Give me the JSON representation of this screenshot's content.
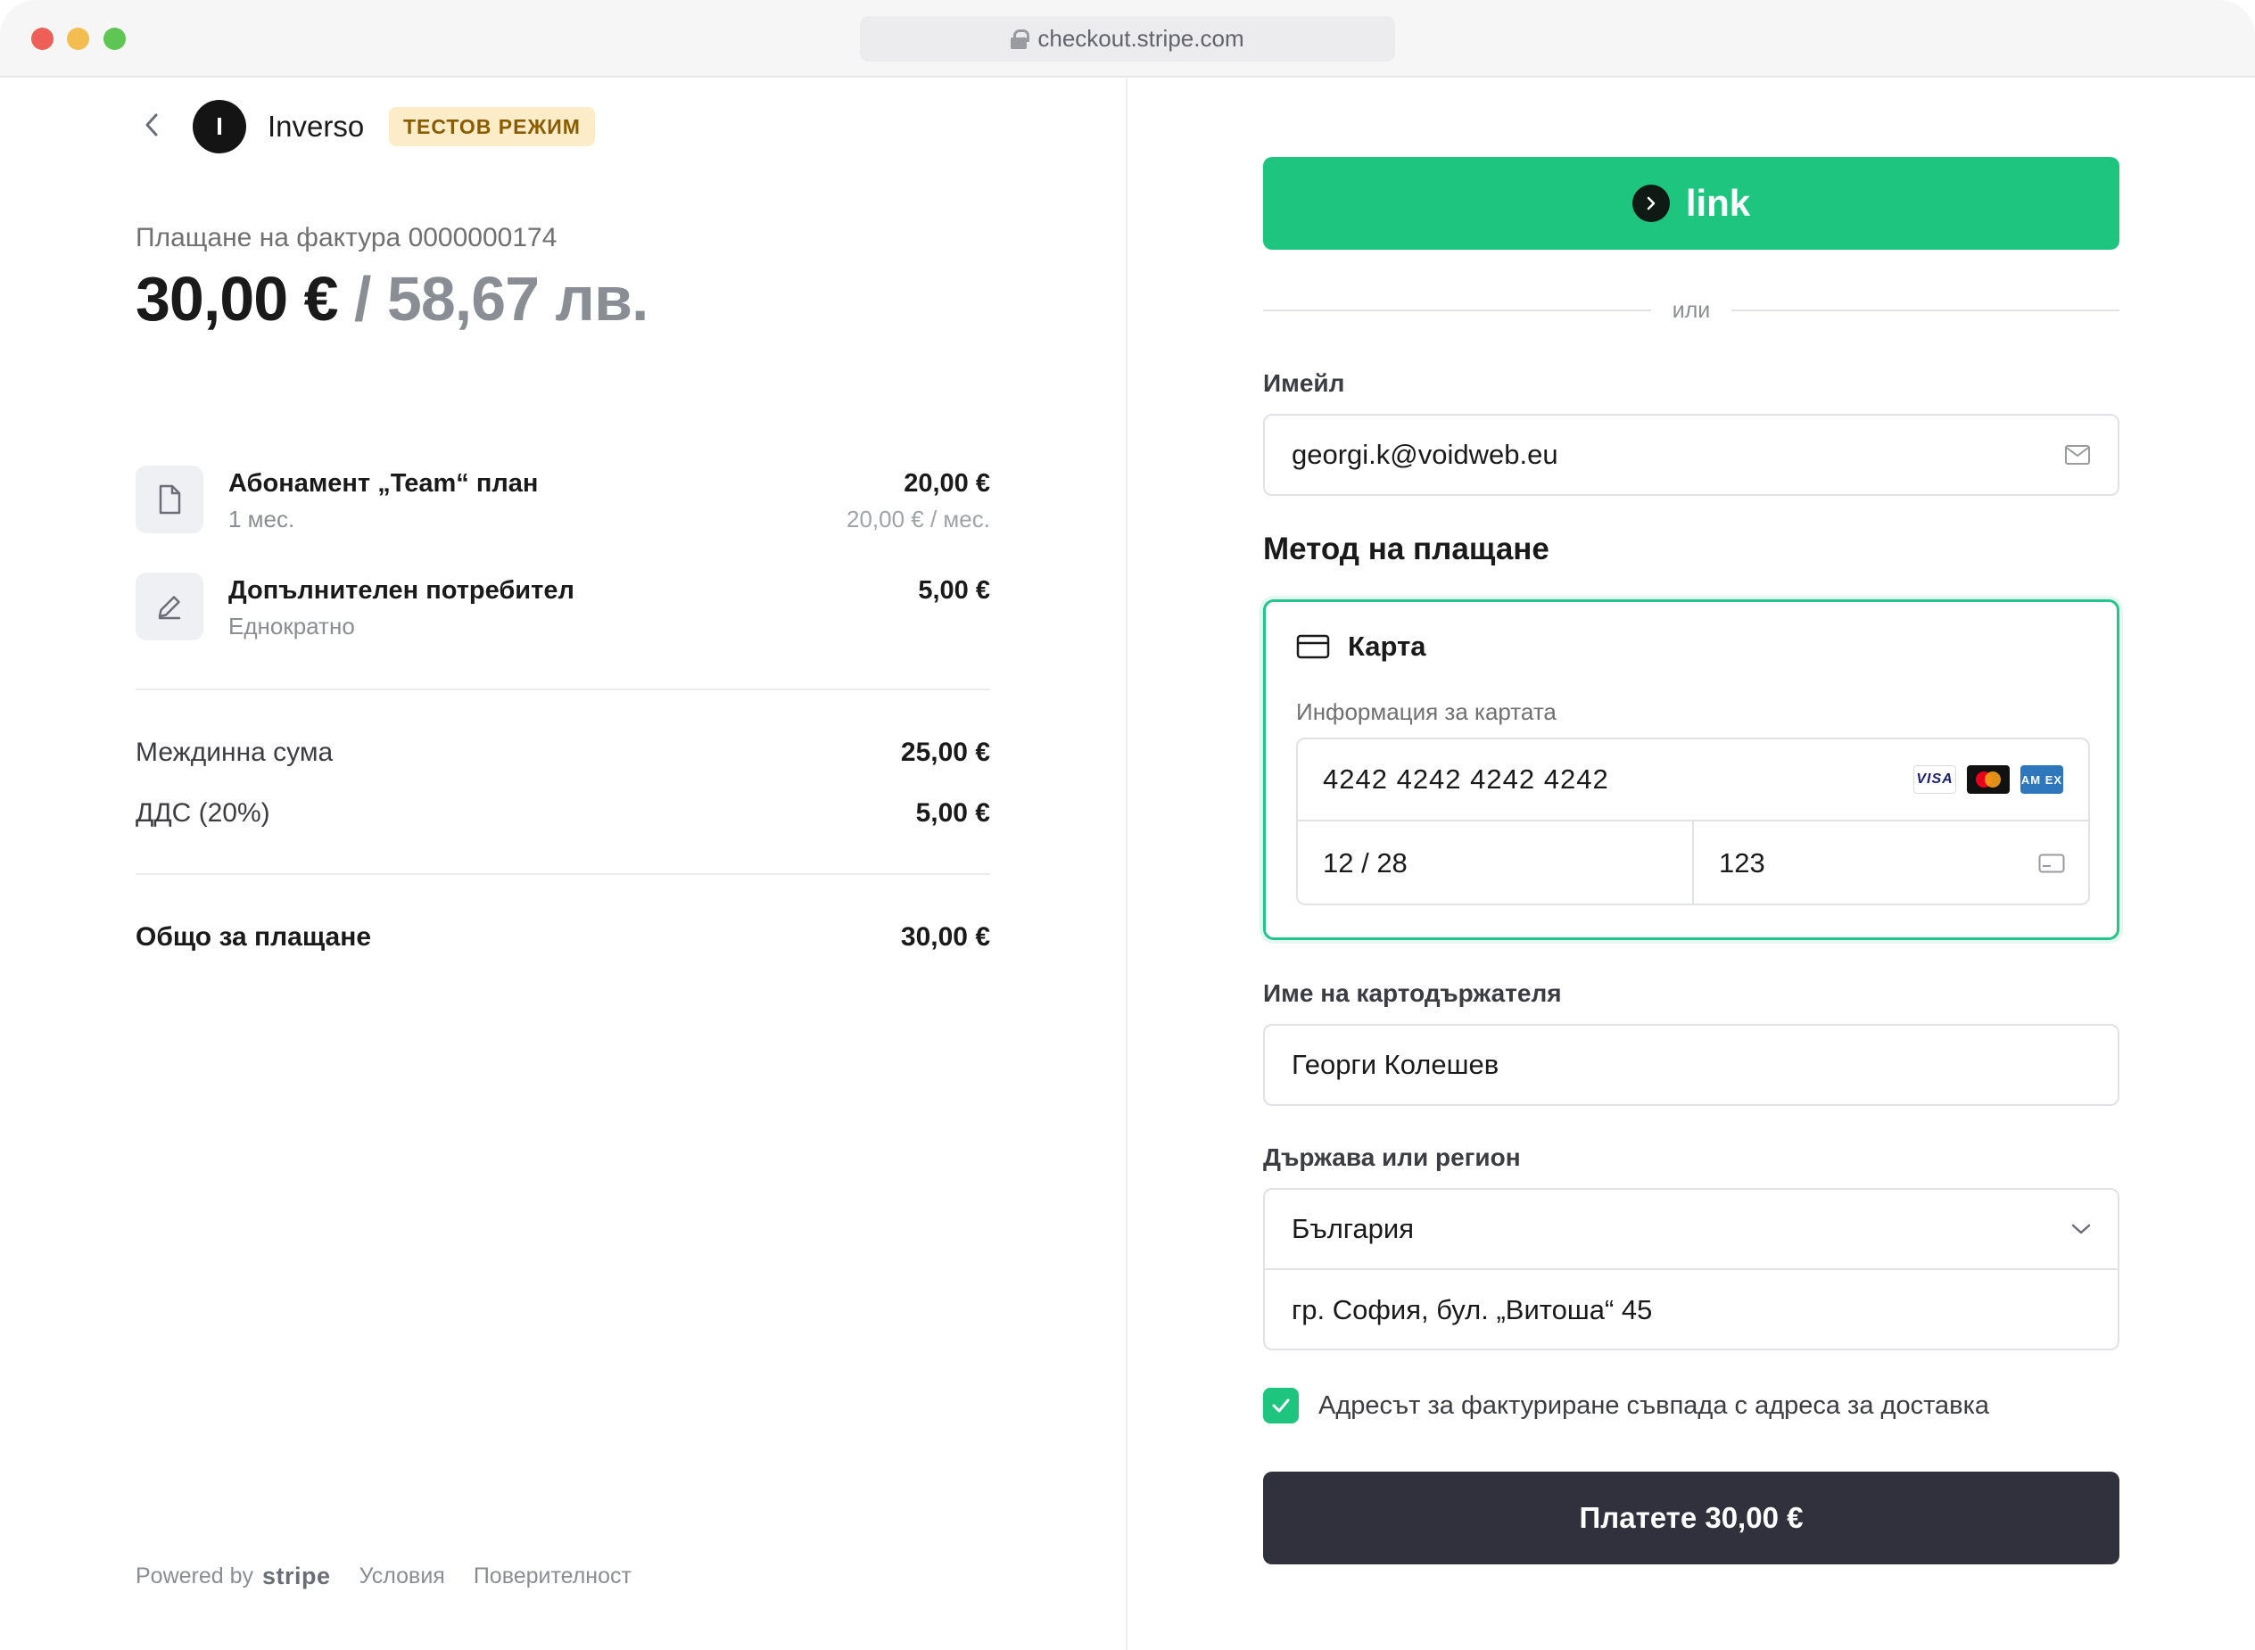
{
  "browser": {
    "url": "checkout.stripe.com"
  },
  "merchant": {
    "initial": "I",
    "name": "Inverso",
    "badge": "ТЕСТОВ РЕЖИМ"
  },
  "invoice": {
    "label": "Плащане на фактура 0000000174",
    "amount_primary": "30,00 €",
    "amount_separator": " / ",
    "amount_secondary": "58,67 лв."
  },
  "line_items": [
    {
      "icon": "document-icon",
      "title": "Абонамент „Team“ план",
      "subtitle": "1 мес.",
      "price": "20,00 €",
      "unit": "20,00 € / мес."
    },
    {
      "icon": "pencil-icon",
      "title": "Допълнителен потребител",
      "subtitle": "Еднократно",
      "price": "5,00 €",
      "unit": ""
    }
  ],
  "summary": {
    "subtotal_label": "Междинна сума",
    "subtotal_value": "25,00 €",
    "vat_label": "ДДС (20%)",
    "vat_value": "5,00 €",
    "total_label": "Общо за плащане",
    "total_value": "30,00 €"
  },
  "footer": {
    "powered_by": "Powered by",
    "brand": "stripe",
    "terms": "Условия",
    "privacy": "Поверителност"
  },
  "link_button": {
    "label": "link"
  },
  "divider": {
    "or": "или"
  },
  "email": {
    "label": "Имейл",
    "value": "georgi.k@voidweb.eu"
  },
  "payment_method": {
    "title": "Метод на плащане",
    "card_tab": "Карта",
    "card_info_label": "Информация за картата",
    "card_number": "4242 4242 4242 4242",
    "expiry": "12 / 28",
    "cvc": "123",
    "brands": {
      "visa": "VISA",
      "amex": "AM EX"
    }
  },
  "cardholder": {
    "label": "Име на картодържателя",
    "value": "Георги Колешев"
  },
  "country": {
    "label": "Държава или регион",
    "value": "България",
    "address": "гр. София, бул. „Витоша“ 45"
  },
  "billing_same": {
    "label": "Адресът за фактуриране съвпада с адреса за доставка",
    "checked": true
  },
  "pay_button": {
    "label": "Платете 30,00 €"
  },
  "colors": {
    "accent_green": "#1ec57f",
    "pay_button": "#30313d",
    "badge_bg": "#fdecc8",
    "badge_text": "#8a5c00"
  }
}
